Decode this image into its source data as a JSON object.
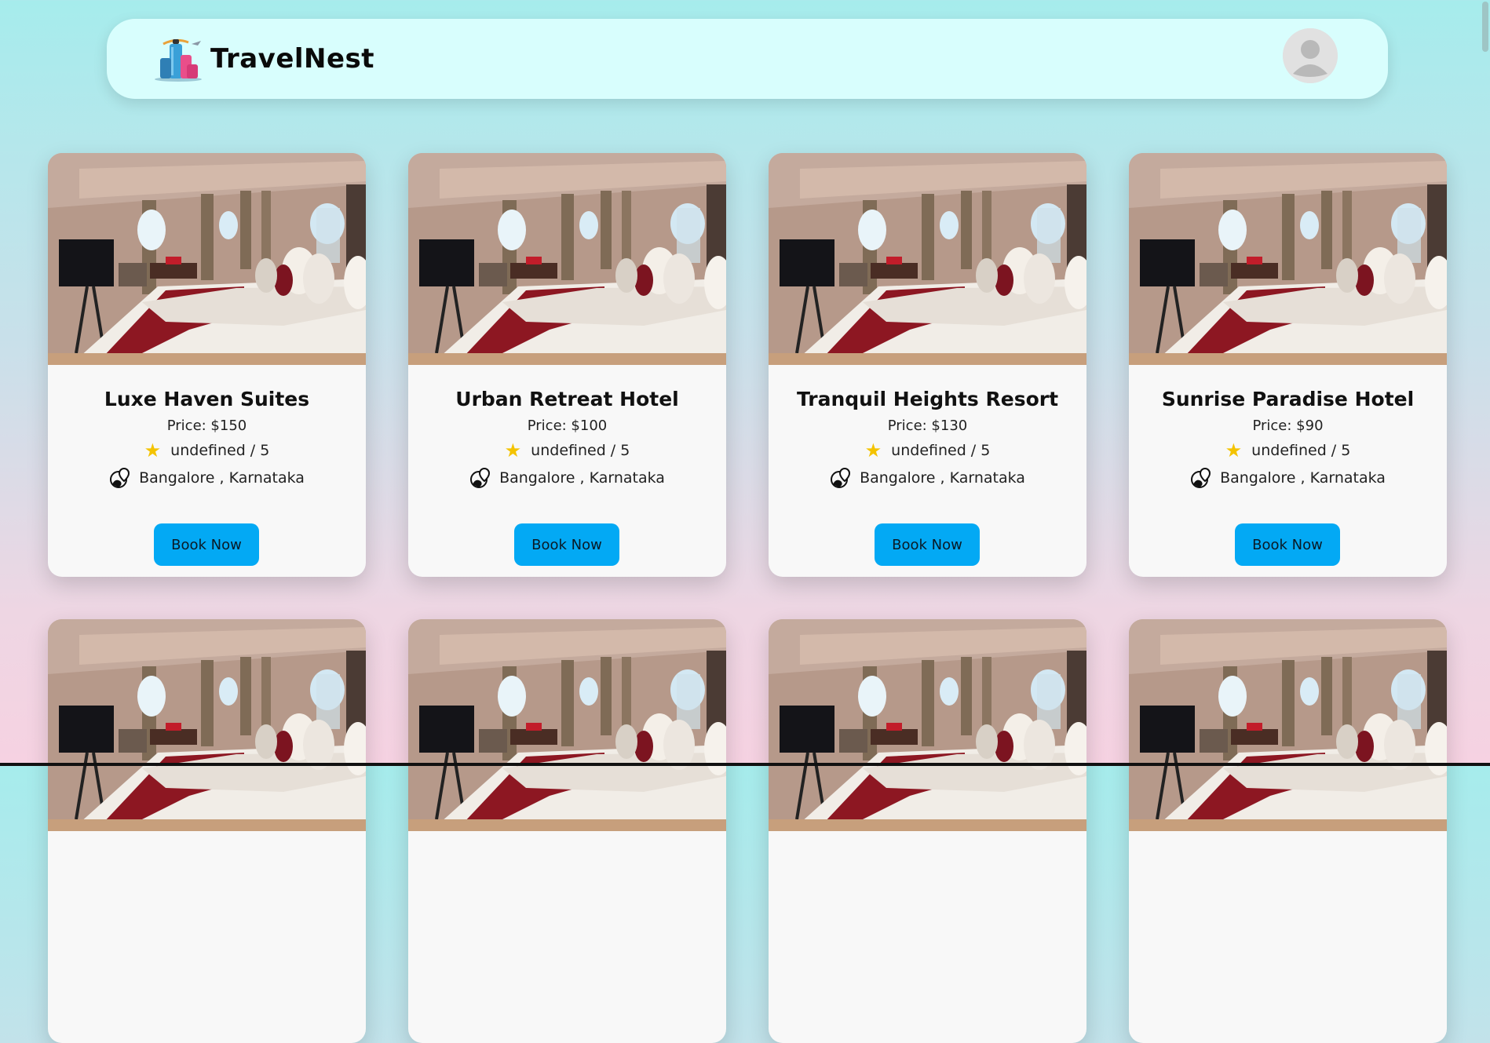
{
  "app": {
    "brand_name": "TravelNest",
    "logo_icon": "luggage-icon",
    "avatar_icon": "user-avatar-icon"
  },
  "colors": {
    "navbar_bg": "#d8fefd",
    "card_bg": "#f8f8f8",
    "button_bg": "#03a9f4",
    "star": "#f4c300"
  },
  "hotels": [
    {
      "name": "Luxe Haven Suites",
      "price": "Price: $150",
      "rating": "undefined / 5",
      "location": "Bangalore , Karnataka",
      "button": "Book Now"
    },
    {
      "name": "Urban Retreat Hotel",
      "price": "Price: $100",
      "rating": "undefined / 5",
      "location": "Bangalore , Karnataka",
      "button": "Book Now"
    },
    {
      "name": "Tranquil Heights Resort",
      "price": "Price: $130",
      "rating": "undefined / 5",
      "location": "Bangalore , Karnataka",
      "button": "Book Now"
    },
    {
      "name": "Sunrise Paradise Hotel",
      "price": "Price: $90",
      "rating": "undefined / 5",
      "location": "Bangalore , Karnataka",
      "button": "Book Now"
    }
  ]
}
